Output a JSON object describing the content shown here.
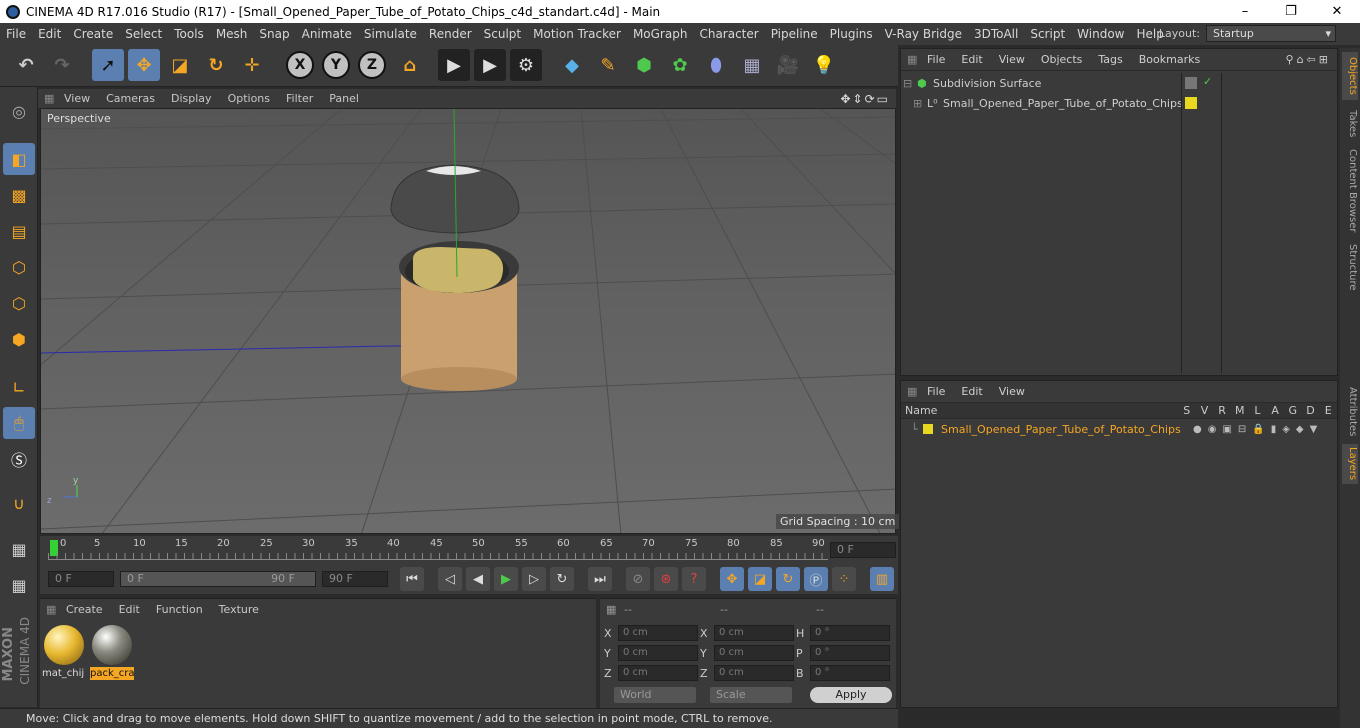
{
  "window": {
    "title": "CINEMA 4D R17.016 Studio (R17) - [Small_Opened_Paper_Tube_of_Potato_Chips_c4d_standart.c4d] - Main",
    "minimize": "–",
    "maximize": "❐",
    "close": "✕"
  },
  "menubar": {
    "items": [
      "File",
      "Edit",
      "Create",
      "Select",
      "Tools",
      "Mesh",
      "Snap",
      "Animate",
      "Simulate",
      "Render",
      "Sculpt",
      "Motion Tracker",
      "MoGraph",
      "Character",
      "Pipeline",
      "Plugins",
      "V-Ray Bridge",
      "3DToAll",
      "Script",
      "Window",
      "Help"
    ],
    "layout_label": "Layout:",
    "layout_value": "Startup"
  },
  "toolbar": {
    "x": "X",
    "y": "Y",
    "z": "Z"
  },
  "viewport": {
    "menu": [
      "View",
      "Cameras",
      "Display",
      "Options",
      "Filter",
      "Panel"
    ],
    "label": "Perspective",
    "grid_spacing": "Grid Spacing : 10 cm",
    "axis_y": "y",
    "axis_z": "z"
  },
  "timeline": {
    "ticks": [
      "0",
      "5",
      "10",
      "15",
      "20",
      "25",
      "30",
      "35",
      "40",
      "45",
      "50",
      "55",
      "60",
      "65",
      "70",
      "75",
      "80",
      "85",
      "90"
    ],
    "current": "0 F"
  },
  "transport": {
    "start": "0 F",
    "range_start": "0 F",
    "range_end": "90 F",
    "end": "90 F"
  },
  "materials": {
    "menu": [
      "Create",
      "Edit",
      "Function",
      "Texture"
    ],
    "items": [
      {
        "label": "mat_chij",
        "color": "#e8b830"
      },
      {
        "label": "pack_cra",
        "color": "#8a8a80"
      }
    ]
  },
  "coords": {
    "headers": [
      "--",
      "--",
      "--"
    ],
    "rows": [
      {
        "l1": "X",
        "v1": "0 cm",
        "l2": "X",
        "v2": "0 cm",
        "l3": "H",
        "v3": "0 °"
      },
      {
        "l1": "Y",
        "v1": "0 cm",
        "l2": "Y",
        "v2": "0 cm",
        "l3": "P",
        "v3": "0 °"
      },
      {
        "l1": "Z",
        "v1": "0 cm",
        "l2": "Z",
        "v2": "0 cm",
        "l3": "B",
        "v3": "0 °"
      }
    ],
    "mode": "World",
    "scale": "Scale",
    "apply": "Apply"
  },
  "status": "Move: Click and drag to move elements. Hold down SHIFT to quantize movement / add to the selection in point mode, CTRL to remove.",
  "objects": {
    "menu": [
      "File",
      "Edit",
      "View",
      "Objects",
      "Tags",
      "Bookmarks"
    ],
    "items": [
      "Subdivision Surface",
      "Small_Opened_Paper_Tube_of_Potato_Chips"
    ]
  },
  "layers": {
    "menu": [
      "File",
      "Edit",
      "View"
    ],
    "col_name": "Name",
    "cols": [
      "S",
      "V",
      "R",
      "M",
      "L",
      "A",
      "G",
      "D",
      "E"
    ],
    "items": [
      "Small_Opened_Paper_Tube_of_Potato_Chips"
    ]
  },
  "sidetabs": [
    "Objects",
    "Takes",
    "Content Browser",
    "Structure",
    "Attributes",
    "Layers"
  ],
  "brand": {
    "maxon": "MAXON",
    "c4d": "CINEMA 4D"
  }
}
